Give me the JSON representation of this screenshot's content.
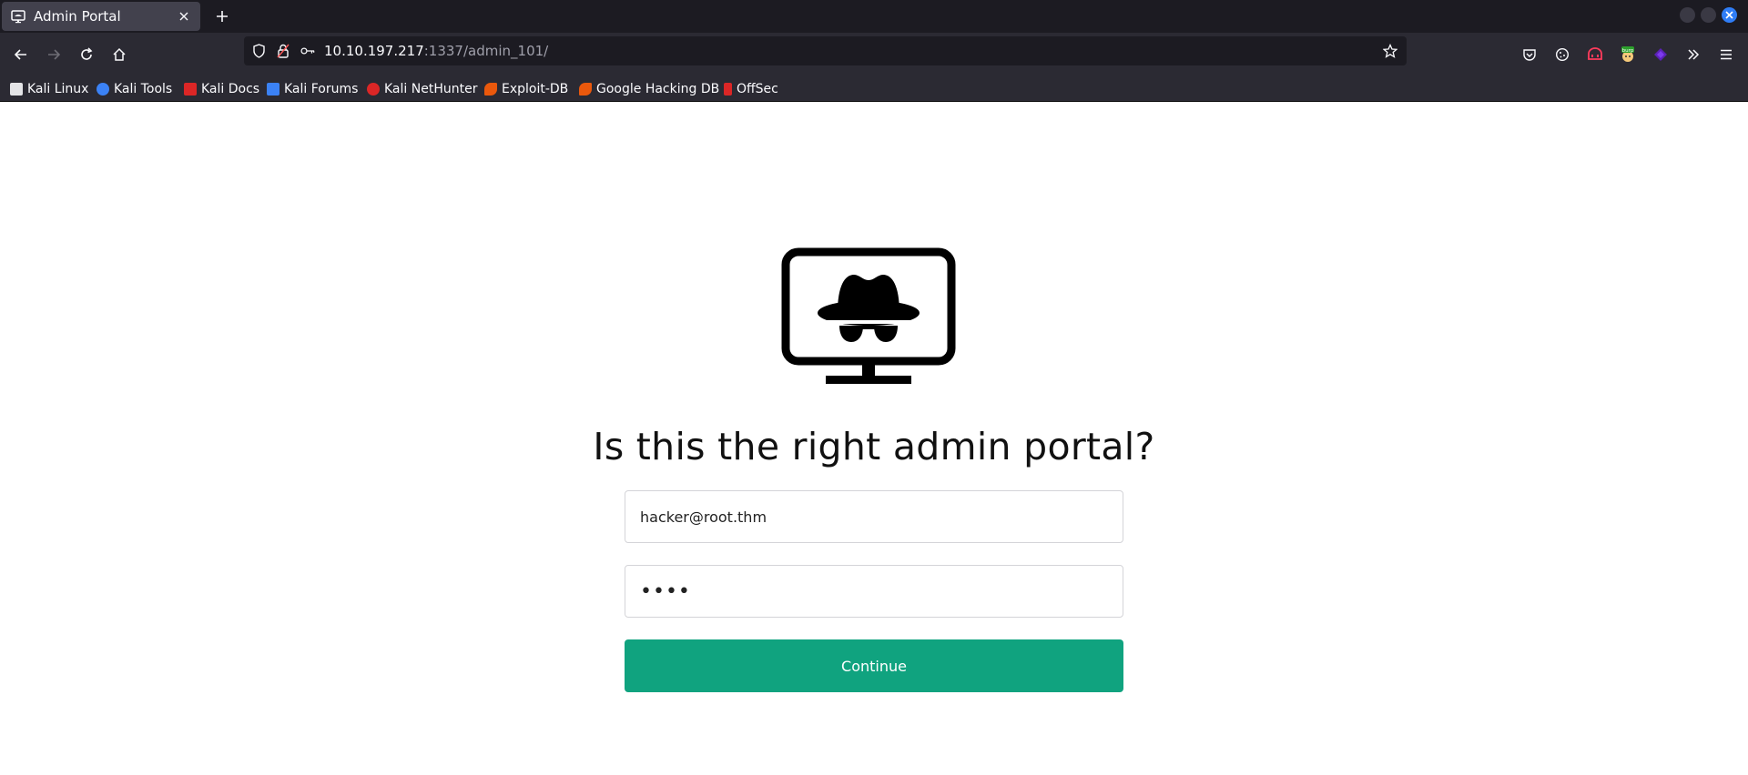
{
  "tab": {
    "title": "Admin Portal",
    "icon": "monitor-icon"
  },
  "url": {
    "host": "10.10.197.217",
    "rest": ":1337/admin_101/"
  },
  "bookmarks": [
    {
      "label": "Kali Linux",
      "color": "#e4e4e7"
    },
    {
      "label": "Kali Tools",
      "color": "#3b82f6"
    },
    {
      "label": "Kali Docs",
      "color": "#dc2626"
    },
    {
      "label": "Kali Forums",
      "color": "#3b82f6"
    },
    {
      "label": "Kali NetHunter",
      "color": "#dc2626"
    },
    {
      "label": "Exploit-DB",
      "color": "#ea580c"
    },
    {
      "label": "Google Hacking DB",
      "color": "#ea580c"
    },
    {
      "label": "OffSec",
      "color": "#dc2626"
    }
  ],
  "page": {
    "heading": "Is this the right admin portal?",
    "email_value": "hacker@root.thm",
    "password_value": "••••",
    "continue_label": "Continue"
  },
  "colors": {
    "accent": "#10a37f",
    "chrome": "#2b2a33",
    "tabbar": "#1c1b22"
  }
}
